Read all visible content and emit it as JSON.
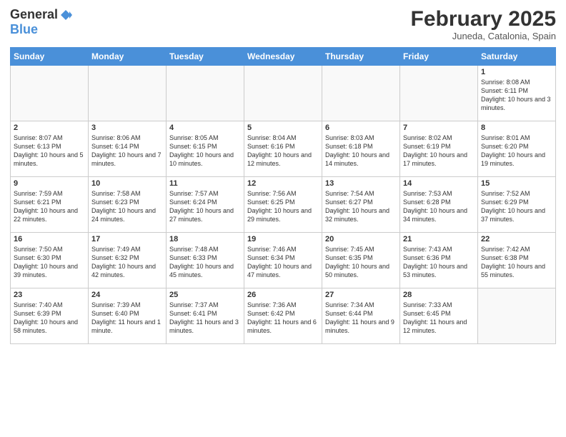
{
  "header": {
    "logo_general": "General",
    "logo_blue": "Blue",
    "title": "February 2025",
    "location": "Juneda, Catalonia, Spain"
  },
  "days_of_week": [
    "Sunday",
    "Monday",
    "Tuesday",
    "Wednesday",
    "Thursday",
    "Friday",
    "Saturday"
  ],
  "weeks": [
    [
      {
        "day": "",
        "info": ""
      },
      {
        "day": "",
        "info": ""
      },
      {
        "day": "",
        "info": ""
      },
      {
        "day": "",
        "info": ""
      },
      {
        "day": "",
        "info": ""
      },
      {
        "day": "",
        "info": ""
      },
      {
        "day": "1",
        "info": "Sunrise: 8:08 AM\nSunset: 6:11 PM\nDaylight: 10 hours and 3 minutes."
      }
    ],
    [
      {
        "day": "2",
        "info": "Sunrise: 8:07 AM\nSunset: 6:13 PM\nDaylight: 10 hours and 5 minutes."
      },
      {
        "day": "3",
        "info": "Sunrise: 8:06 AM\nSunset: 6:14 PM\nDaylight: 10 hours and 7 minutes."
      },
      {
        "day": "4",
        "info": "Sunrise: 8:05 AM\nSunset: 6:15 PM\nDaylight: 10 hours and 10 minutes."
      },
      {
        "day": "5",
        "info": "Sunrise: 8:04 AM\nSunset: 6:16 PM\nDaylight: 10 hours and 12 minutes."
      },
      {
        "day": "6",
        "info": "Sunrise: 8:03 AM\nSunset: 6:18 PM\nDaylight: 10 hours and 14 minutes."
      },
      {
        "day": "7",
        "info": "Sunrise: 8:02 AM\nSunset: 6:19 PM\nDaylight: 10 hours and 17 minutes."
      },
      {
        "day": "8",
        "info": "Sunrise: 8:01 AM\nSunset: 6:20 PM\nDaylight: 10 hours and 19 minutes."
      }
    ],
    [
      {
        "day": "9",
        "info": "Sunrise: 7:59 AM\nSunset: 6:21 PM\nDaylight: 10 hours and 22 minutes."
      },
      {
        "day": "10",
        "info": "Sunrise: 7:58 AM\nSunset: 6:23 PM\nDaylight: 10 hours and 24 minutes."
      },
      {
        "day": "11",
        "info": "Sunrise: 7:57 AM\nSunset: 6:24 PM\nDaylight: 10 hours and 27 minutes."
      },
      {
        "day": "12",
        "info": "Sunrise: 7:56 AM\nSunset: 6:25 PM\nDaylight: 10 hours and 29 minutes."
      },
      {
        "day": "13",
        "info": "Sunrise: 7:54 AM\nSunset: 6:27 PM\nDaylight: 10 hours and 32 minutes."
      },
      {
        "day": "14",
        "info": "Sunrise: 7:53 AM\nSunset: 6:28 PM\nDaylight: 10 hours and 34 minutes."
      },
      {
        "day": "15",
        "info": "Sunrise: 7:52 AM\nSunset: 6:29 PM\nDaylight: 10 hours and 37 minutes."
      }
    ],
    [
      {
        "day": "16",
        "info": "Sunrise: 7:50 AM\nSunset: 6:30 PM\nDaylight: 10 hours and 39 minutes."
      },
      {
        "day": "17",
        "info": "Sunrise: 7:49 AM\nSunset: 6:32 PM\nDaylight: 10 hours and 42 minutes."
      },
      {
        "day": "18",
        "info": "Sunrise: 7:48 AM\nSunset: 6:33 PM\nDaylight: 10 hours and 45 minutes."
      },
      {
        "day": "19",
        "info": "Sunrise: 7:46 AM\nSunset: 6:34 PM\nDaylight: 10 hours and 47 minutes."
      },
      {
        "day": "20",
        "info": "Sunrise: 7:45 AM\nSunset: 6:35 PM\nDaylight: 10 hours and 50 minutes."
      },
      {
        "day": "21",
        "info": "Sunrise: 7:43 AM\nSunset: 6:36 PM\nDaylight: 10 hours and 53 minutes."
      },
      {
        "day": "22",
        "info": "Sunrise: 7:42 AM\nSunset: 6:38 PM\nDaylight: 10 hours and 55 minutes."
      }
    ],
    [
      {
        "day": "23",
        "info": "Sunrise: 7:40 AM\nSunset: 6:39 PM\nDaylight: 10 hours and 58 minutes."
      },
      {
        "day": "24",
        "info": "Sunrise: 7:39 AM\nSunset: 6:40 PM\nDaylight: 11 hours and 1 minute."
      },
      {
        "day": "25",
        "info": "Sunrise: 7:37 AM\nSunset: 6:41 PM\nDaylight: 11 hours and 3 minutes."
      },
      {
        "day": "26",
        "info": "Sunrise: 7:36 AM\nSunset: 6:42 PM\nDaylight: 11 hours and 6 minutes."
      },
      {
        "day": "27",
        "info": "Sunrise: 7:34 AM\nSunset: 6:44 PM\nDaylight: 11 hours and 9 minutes."
      },
      {
        "day": "28",
        "info": "Sunrise: 7:33 AM\nSunset: 6:45 PM\nDaylight: 11 hours and 12 minutes."
      },
      {
        "day": "",
        "info": ""
      }
    ]
  ]
}
